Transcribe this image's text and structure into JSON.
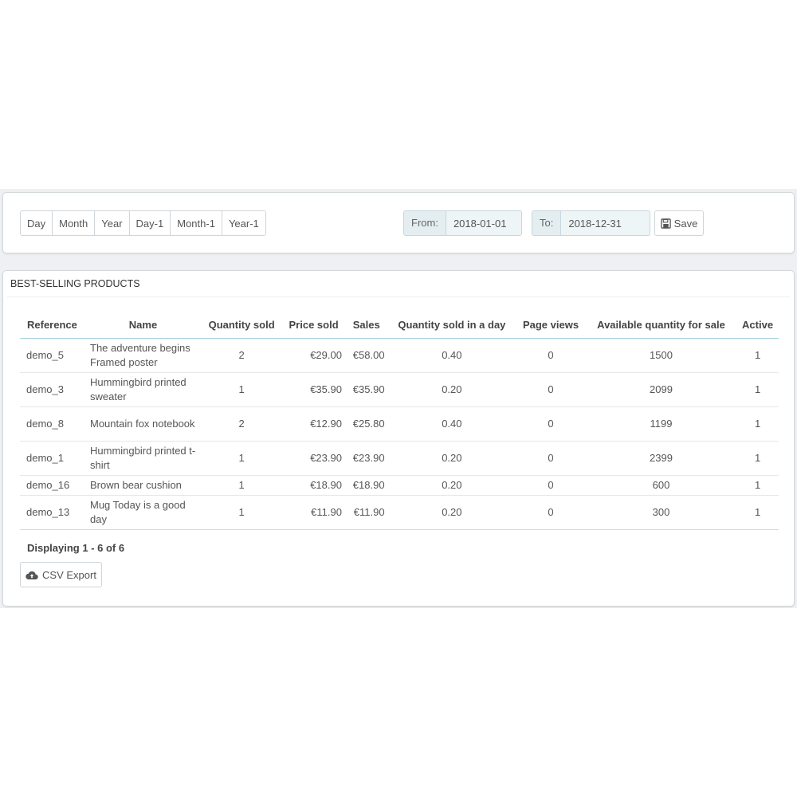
{
  "toolbar": {
    "periods": [
      "Day",
      "Month",
      "Year",
      "Day-1",
      "Month-1",
      "Year-1"
    ],
    "from_label": "From:",
    "from_value": "2018-01-01",
    "to_label": "To:",
    "to_value": "2018-12-31",
    "save_label": "Save",
    "save_icon": "floppy-disk-icon"
  },
  "products": {
    "heading": "BEST-SELLING PRODUCTS",
    "columns": [
      "Reference",
      "Name",
      "Quantity sold",
      "Price sold",
      "Sales",
      "Quantity sold in a day",
      "Page views",
      "Available quantity for sale",
      "Active"
    ],
    "rows": [
      {
        "reference": "demo_5",
        "name": "The adventure begins Framed poster",
        "quantity_sold": "2",
        "price_sold": "€29.00",
        "sales": "€58.00",
        "per_day": "0.40",
        "page_views": "0",
        "available": "1500",
        "active": "1"
      },
      {
        "reference": "demo_3",
        "name": "Hummingbird printed sweater",
        "quantity_sold": "1",
        "price_sold": "€35.90",
        "sales": "€35.90",
        "per_day": "0.20",
        "page_views": "0",
        "available": "2099",
        "active": "1"
      },
      {
        "reference": "demo_8",
        "name": "Mountain fox notebook",
        "quantity_sold": "2",
        "price_sold": "€12.90",
        "sales": "€25.80",
        "per_day": "0.40",
        "page_views": "0",
        "available": "1199",
        "active": "1"
      },
      {
        "reference": "demo_1",
        "name": "Hummingbird printed t-shirt",
        "quantity_sold": "1",
        "price_sold": "€23.90",
        "sales": "€23.90",
        "per_day": "0.20",
        "page_views": "0",
        "available": "2399",
        "active": "1"
      },
      {
        "reference": "demo_16",
        "name": "Brown bear cushion",
        "quantity_sold": "1",
        "price_sold": "€18.90",
        "sales": "€18.90",
        "per_day": "0.20",
        "page_views": "0",
        "available": "600",
        "active": "1"
      },
      {
        "reference": "demo_13",
        "name": "Mug Today is a good day",
        "quantity_sold": "1",
        "price_sold": "€11.90",
        "sales": "€11.90",
        "per_day": "0.20",
        "page_views": "0",
        "available": "300",
        "active": "1"
      }
    ],
    "displaying": "Displaying 1 - 6 of 6",
    "csv_label": "CSV Export",
    "csv_icon": "cloud-upload-icon"
  }
}
